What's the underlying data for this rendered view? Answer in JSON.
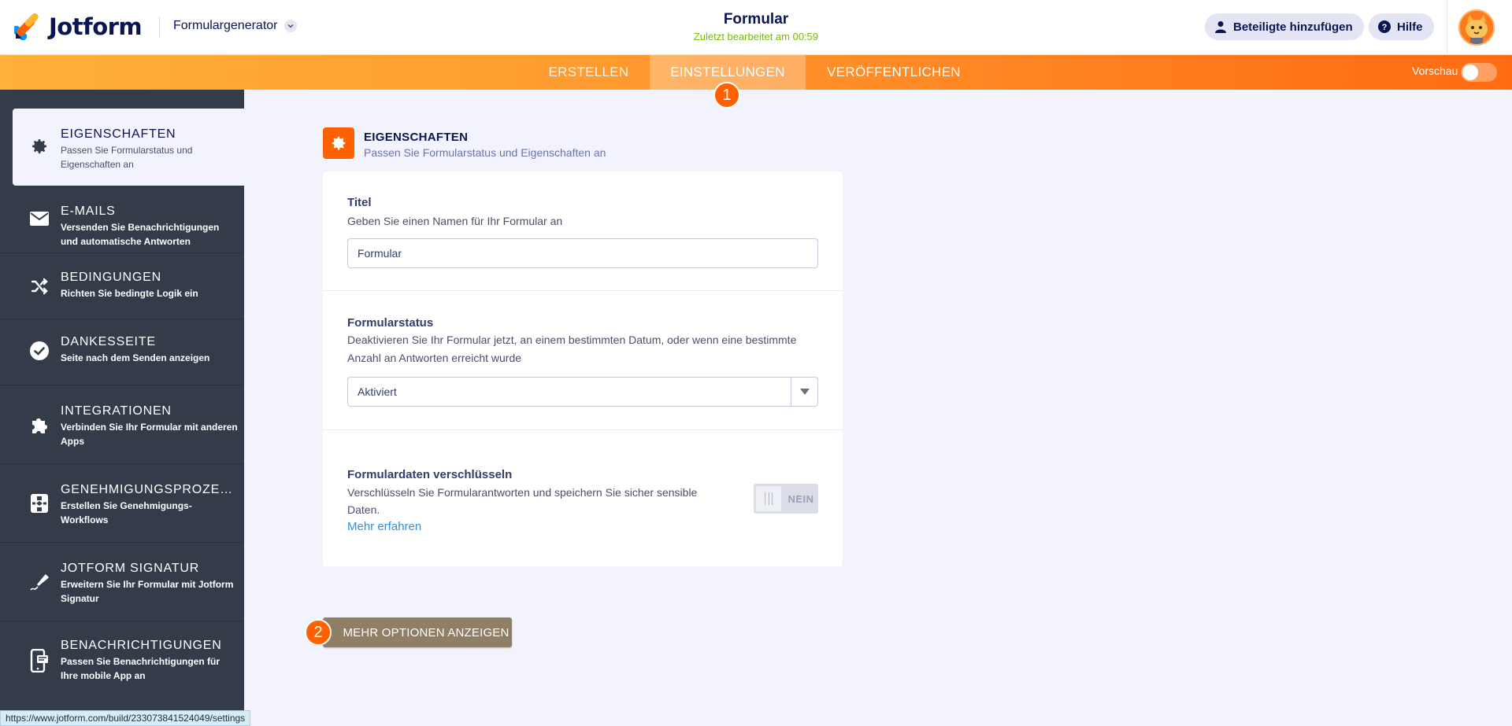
{
  "header": {
    "logo_text": "Jotform",
    "generator_label": "Formulargenerator",
    "form_title": "Formular",
    "last_edited": "Zuletzt bearbeitet am 00:59",
    "participants_label": "Beteiligte hinzufügen",
    "help_label": "Hilfe"
  },
  "nav": {
    "tabs": [
      {
        "label": "ERSTELLEN"
      },
      {
        "label": "EINSTELLUNGEN",
        "active": true
      },
      {
        "label": "VERÖFFENTLICHEN"
      }
    ],
    "preview_label": "Vorschau"
  },
  "steps": {
    "one": "1",
    "two": "2"
  },
  "sidebar": {
    "items": [
      {
        "title": "EIGENSCHAFTEN",
        "desc": "Passen Sie Formularstatus und Eigenschaften an",
        "icon": "gear-icon",
        "active": true
      },
      {
        "title": "E-MAILS",
        "desc": "Versenden Sie Benachrichtigungen und automatische Antworten",
        "icon": "envelope-icon"
      },
      {
        "title": "BEDINGUNGEN",
        "desc": "Richten Sie bedingte Logik ein",
        "icon": "shuffle-icon"
      },
      {
        "title": "DANKESSEITE",
        "desc": "Seite nach dem Senden anzeigen",
        "icon": "check-circle-icon"
      },
      {
        "title": "INTEGRATIONEN",
        "desc": "Verbinden Sie Ihr Formular mit anderen Apps",
        "icon": "puzzle-icon"
      },
      {
        "title": "GENEHMIGUNGSPROZES...",
        "desc": "Erstellen Sie Genehmigungs-Workflows",
        "icon": "workflow-icon"
      },
      {
        "title": "JOTFORM SIGNATUR",
        "desc": "Erweitern Sie Ihr Formular mit Jotform Signatur",
        "icon": "signature-pen-icon"
      },
      {
        "title": "BENACHRICHTIGUNGEN",
        "desc": "Passen Sie Benachrichtigungen für Ihre mobile App an",
        "icon": "mobile-notification-icon"
      }
    ]
  },
  "section": {
    "title": "EIGENSCHAFTEN",
    "subtitle": "Passen Sie Formularstatus und Eigenschaften an"
  },
  "settings": {
    "title_label": "Titel",
    "title_desc": "Geben Sie einen Namen für Ihr Formular an",
    "title_value": "Formular",
    "status_label": "Formularstatus",
    "status_desc": "Deaktivieren Sie Ihr Formular jetzt, an einem bestimmten Datum, oder wenn eine bestimmte Anzahl an Antworten erreicht wurde",
    "status_value": "Aktiviert",
    "encrypt_label": "Formulardaten verschlüsseln",
    "encrypt_desc": "Verschlüsseln Sie Formularantworten und speichern Sie sicher sensible Daten.",
    "learn_more": "Mehr erfahren",
    "encrypt_toggle": "NEIN"
  },
  "more_options": "MEHR OPTIONEN ANZEIGEN",
  "status_url": "https://www.jotform.com/build/233073841524049/settings",
  "colors": {
    "accent": "#ff6100",
    "sidebar": "#343c4a",
    "link": "#2e8fe8",
    "edited": "#78bb07"
  }
}
